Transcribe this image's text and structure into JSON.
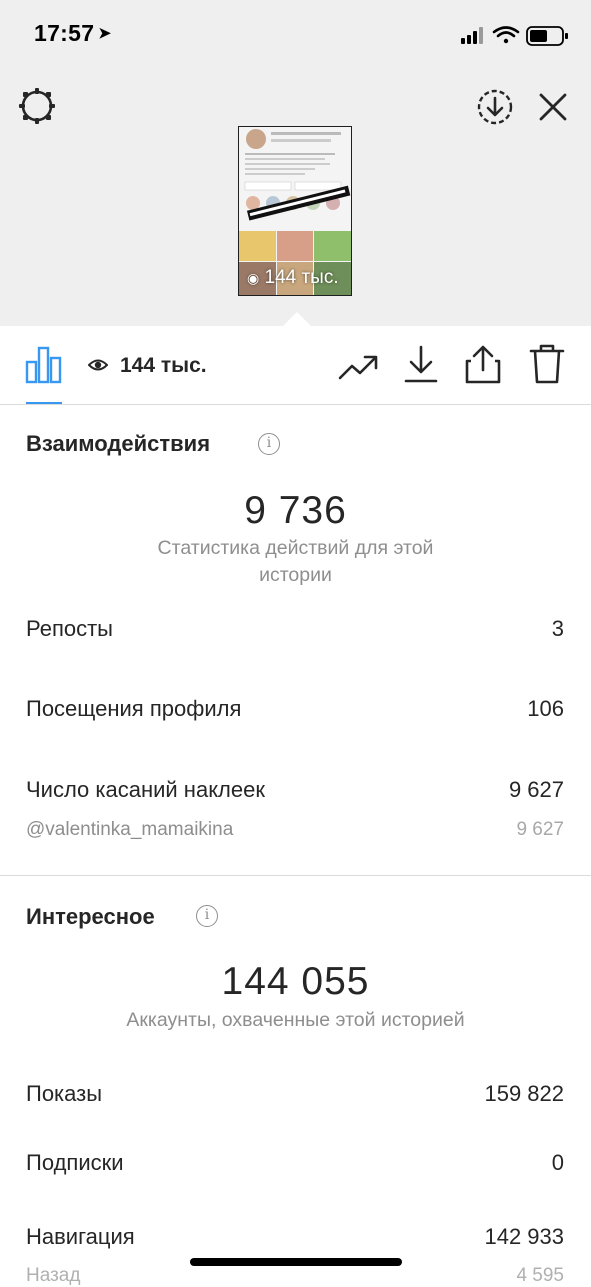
{
  "status_bar": {
    "time": "17:57",
    "location_arrow": "location-arrow-icon",
    "icons": [
      "signal-icon",
      "wifi-icon",
      "battery-icon"
    ]
  },
  "header": {
    "settings_icon": "gear-icon",
    "download_circle_icon": "download-circle-icon",
    "close_icon": "close-icon"
  },
  "story_thumbnail": {
    "views": "144 тыс."
  },
  "toolbar": {
    "insights_tab_icon": "bar-chart-icon",
    "reach_icon": "eye-icon",
    "reach_count": "144 тыс.",
    "actions": [
      "trending-icon",
      "download-icon",
      "share-icon",
      "trash-icon"
    ]
  },
  "interactions": {
    "title": "Взаимодействия",
    "total": "9 736",
    "description": "Статистика действий для этой истории",
    "rows": [
      {
        "label": "Репосты",
        "value": "3"
      },
      {
        "label": "Посещения профиля",
        "value": "106"
      },
      {
        "label": "Число касаний наклеек",
        "value": "9 627"
      }
    ],
    "sub_rows": [
      {
        "label": "@valentinka_mamaikina",
        "value": "9 627"
      }
    ]
  },
  "discovery": {
    "title": "Интересное",
    "total": "144 055",
    "description": "Аккаунты, охваченные этой историей",
    "rows": [
      {
        "label": "Показы",
        "value": "159 822"
      },
      {
        "label": "Подписки",
        "value": "0"
      },
      {
        "label": "Навигация",
        "value": "142 933"
      }
    ],
    "sub_rows": [
      {
        "label": "Назад",
        "value": "4 595"
      }
    ]
  },
  "colors": {
    "accent": "#3897f0",
    "text": "#262626",
    "secondary_text": "#8e8e8e",
    "header_bg": "#efefef"
  }
}
